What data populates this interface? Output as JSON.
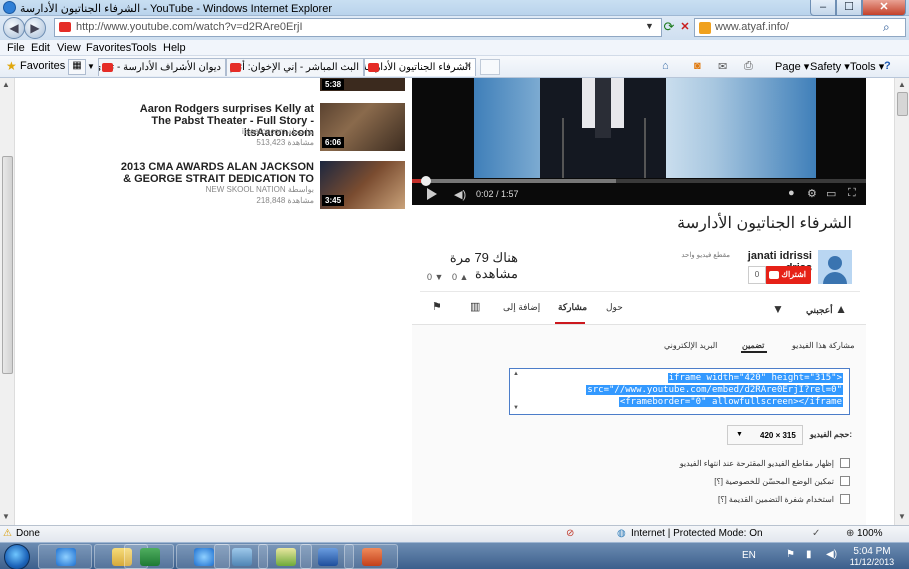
{
  "window": {
    "title": "الشرفاء الجناتيون الأدارسة - YouTube - Windows Internet Explorer",
    "min": "–",
    "max": "☐",
    "close": "✕"
  },
  "nav": {
    "url": "http://www.youtube.com/watch?v=d2RAre0ErjI",
    "search_text": "www.atyaf.info/"
  },
  "menu": [
    "File",
    "Edit",
    "View",
    "Favorites",
    "Tools",
    "Help"
  ],
  "favbar": {
    "favorites": "Favorites",
    "tabs": [
      "ديوان الأشراف الأدارسة - تعدي",
      "البث المباشر - إني الإخوان: أئتم",
      "الشرفاء الجناتيون الأدارسة ..."
    ],
    "commands": [
      "Page ▾",
      "Safety ▾",
      "Tools ▾",
      "?"
    ]
  },
  "related": [
    {
      "title": "Aaron Rodgers surprises Kelly at The Pabst Theater - Full Story - itsAaron.com",
      "channel": "itsaaroncom",
      "by": "بواسطة",
      "views": "513,423 مشاهدة",
      "duration": "6:06"
    },
    {
      "title": "2013 CMA AWARDS ALAN JACKSON & GEORGE STRAIT DEDICATION TO",
      "channel": "NEW SKOOL NATION",
      "by": "بواسطة",
      "views": "218,848 مشاهدة",
      "duration": "3:45"
    }
  ],
  "top_thumb_duration": "5:38",
  "player": {
    "time": "0:02 / 1:57",
    "progress": 0.02,
    "loaded": 0.45
  },
  "video": {
    "title": "الشرفاء الجناتيون الأدارسة",
    "channel": "janati idrissi driss",
    "channel_videos": "مقطع فيديو واحد",
    "subscribe": "اشتراك",
    "sub_count": "0",
    "views": "هناك 79 مرة مشاهدة",
    "likes": "0",
    "dislikes": "0"
  },
  "actions": {
    "like": "أعجبني",
    "about": "حول",
    "share": "مشاركة",
    "add_to": "إضافة إلى"
  },
  "share_tabs": {
    "share": "مشاركة هذا الفيديو",
    "embed": "تضمين",
    "email": "البريد الإلكتروني"
  },
  "embed_lines": [
    "iframe width=\"420\" height=\"315\">",
    "src=\"//www.youtube.com/embed/d2RAre0ErjI?rel=0\"",
    "<frameborder=\"0\" allowfullscreen></iframe"
  ],
  "size": {
    "label": "حجم الفيديو:",
    "value": "420 × 315"
  },
  "options": [
    "إظهار مقاطع الفيديو المقترحة عند انتهاء الفيديو",
    "تمكين الوضع المحسّن للخصوصية [؟]",
    "استخدام شفرة التضمين القديمة [؟]"
  ],
  "status": {
    "text": "Done",
    "zone": "Internet | Protected Mode: On",
    "zoom": "100%"
  },
  "tray": {
    "lang": "EN",
    "time": "5:04 PM",
    "date": "11/12/2013"
  },
  "colors": {
    "youtube_red": "#e52d27",
    "selection": "#3399ff",
    "taskbar": "#3c5f8c"
  }
}
